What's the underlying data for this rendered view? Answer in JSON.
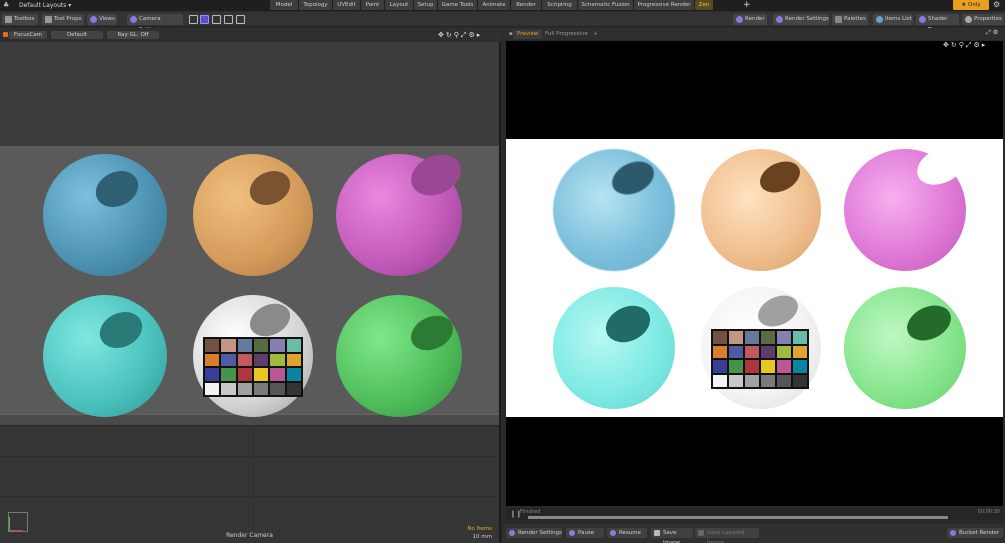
{
  "topbar": {
    "layouts_label": "Default Layouts ▾",
    "tabs": [
      "Model",
      "Topology",
      "UVEdit",
      "Paint",
      "Layout",
      "Setup",
      "Game Tools",
      "Animate",
      "Render",
      "Scripting",
      "Schematic Fusion",
      "Progressive Render",
      "Zen"
    ],
    "active_tab": "Zen",
    "only_label": "★  Only"
  },
  "toolbar": {
    "toolbox": "Toolbox",
    "tool_props": "Tool Props",
    "views": "Views",
    "camera_settings": "Camera Settings",
    "render": "Render",
    "render_settings": "Render Settings",
    "palettes": "Palettes",
    "items_list": "Items List",
    "shader_tree": "Shader Tree",
    "properties": "Properties"
  },
  "left_viewport": {
    "camera_pill": "FocusCam",
    "style_pill": "Default",
    "raygl_pill": "Ray GL: Off",
    "camera_label": "Render Camera",
    "no_items": "No Items",
    "scale": "10 mm"
  },
  "right_panel": {
    "tab_preview": "Preview",
    "tab_full": "Full Progressive",
    "status": "Finished",
    "time": "00:00:30",
    "progress": 1.0,
    "buttons": {
      "render_settings": "Render Settings",
      "pause": "Pause",
      "resume": "Resume",
      "save_image": "Save Image",
      "save_layered": "Save Layered Image",
      "bucket_render": "Bucket Render"
    }
  },
  "colors": {
    "accent": "#e8a020",
    "sphere_blue": "#5aa8c8",
    "sphere_orange": "#e0a060",
    "sphere_magenta": "#d060c8",
    "sphere_cyan": "#50d0d0",
    "sphere_green": "#50c060"
  },
  "checker_colors": [
    "#735244",
    "#c29682",
    "#627a9d",
    "#576c43",
    "#8580b1",
    "#67bdaa",
    "#d67e2c",
    "#505ba6",
    "#c15a63",
    "#5e3c6c",
    "#9dbc40",
    "#e0a32e",
    "#383d96",
    "#469449",
    "#af363c",
    "#e7c71f",
    "#bb5695",
    "#0885a1",
    "#f3f3f2",
    "#c8c8c8",
    "#a0a0a0",
    "#7a7a79",
    "#555555",
    "#343434"
  ]
}
